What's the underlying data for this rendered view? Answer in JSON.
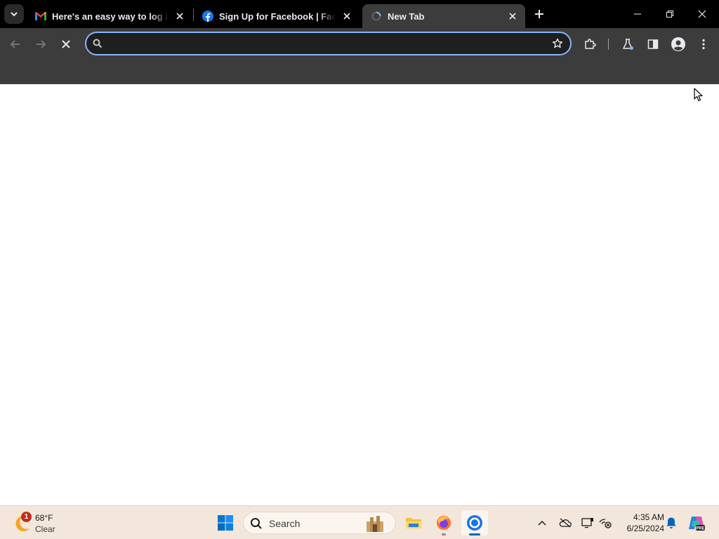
{
  "browser": {
    "tabs": [
      {
        "title": "Here's an easy way to log into",
        "favicon": "gmail-icon",
        "active": false
      },
      {
        "title": "Sign Up for Facebook | Facebook",
        "favicon": "facebook-icon",
        "active": false
      },
      {
        "title": "New Tab",
        "favicon": "chrome-newtab-icon",
        "active": true
      }
    ],
    "omnibox": {
      "value": "",
      "placeholder": ""
    },
    "colors": {
      "accent": "#8ab4f8",
      "toolbar": "#3c3c3c",
      "tabstrip": "#000000"
    }
  },
  "taskbar": {
    "weather": {
      "temp": "68°F",
      "condition": "Clear",
      "badge": "1"
    },
    "search_label": "Search",
    "clock": {
      "time": "4:35 AM",
      "date": "6/25/2024"
    },
    "apps": [
      "file-explorer-icon",
      "firefox-icon",
      "chrome-icon"
    ],
    "tray": [
      "chevron-up-icon",
      "onedrive-icon",
      "display-icon",
      "network-icon",
      "notification-bell-icon",
      "copilot-icon"
    ]
  }
}
